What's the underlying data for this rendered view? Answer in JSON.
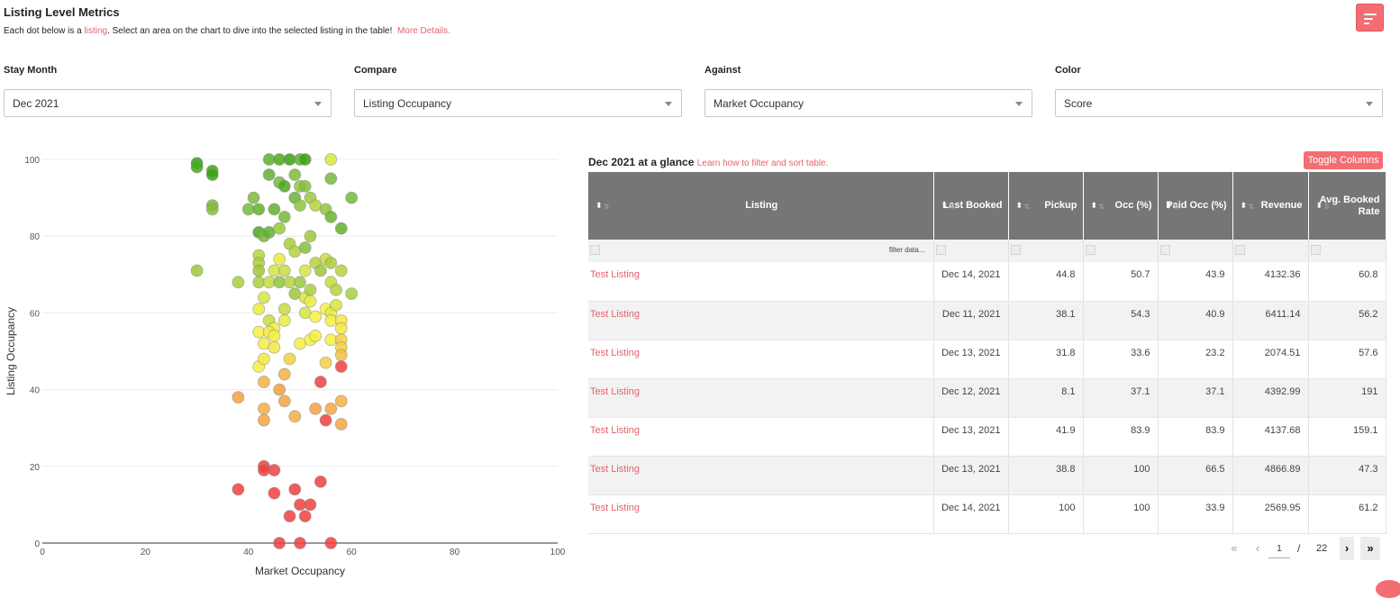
{
  "header": {
    "title": "Listing Level Metrics",
    "subtitle_prefix": "Each dot below is a ",
    "subtitle_link": "listing",
    "subtitle_mid": ". Select an area on the chart to dive into the selected listing in the table!",
    "more_details": "More Details."
  },
  "filters": [
    {
      "label": "Stay Month",
      "value": "Dec 2021"
    },
    {
      "label": "Compare",
      "value": "Listing Occupancy"
    },
    {
      "label": "Against",
      "value": "Market Occupancy"
    },
    {
      "label": "Color",
      "value": "Score"
    }
  ],
  "chart_data": {
    "type": "scatter",
    "xlabel": "Market Occupancy",
    "ylabel": "Listing Occupancy",
    "xlim": [
      0,
      100
    ],
    "ylim": [
      0,
      100
    ],
    "xticks": [
      0,
      20,
      40,
      60,
      80,
      100
    ],
    "yticks": [
      0,
      20,
      40,
      60,
      80,
      100
    ],
    "grid": true,
    "points": [
      {
        "x": 30,
        "y": 99,
        "c": "#34a012"
      },
      {
        "x": 30,
        "y": 98,
        "c": "#4aa81d"
      },
      {
        "x": 33,
        "y": 97,
        "c": "#43a51a"
      },
      {
        "x": 33,
        "y": 96,
        "c": "#3aa116"
      },
      {
        "x": 33,
        "y": 88,
        "c": "#76b83a"
      },
      {
        "x": 33,
        "y": 87,
        "c": "#83c03c"
      },
      {
        "x": 30,
        "y": 71,
        "c": "#9cc83a"
      },
      {
        "x": 38,
        "y": 68,
        "c": "#a8cf3c"
      },
      {
        "x": 40,
        "y": 87,
        "c": "#76b83a"
      },
      {
        "x": 41,
        "y": 90,
        "c": "#7ebb38"
      },
      {
        "x": 42,
        "y": 87,
        "c": "#5fb02d"
      },
      {
        "x": 42,
        "y": 81,
        "c": "#4aa81d"
      },
      {
        "x": 43,
        "y": 80,
        "c": "#76b83a"
      },
      {
        "x": 44,
        "y": 81,
        "c": "#5fb02d"
      },
      {
        "x": 42,
        "y": 75,
        "c": "#b4d33d"
      },
      {
        "x": 42,
        "y": 73,
        "c": "#a8cf3c"
      },
      {
        "x": 42,
        "y": 71,
        "c": "#9cc83a"
      },
      {
        "x": 42,
        "y": 68,
        "c": "#a8cf3c"
      },
      {
        "x": 44,
        "y": 68,
        "c": "#c6dc3e"
      },
      {
        "x": 46,
        "y": 68,
        "c": "#8ec43c"
      },
      {
        "x": 48,
        "y": 68,
        "c": "#b4d33d"
      },
      {
        "x": 44,
        "y": 100,
        "c": "#5fb02d"
      },
      {
        "x": 46,
        "y": 100,
        "c": "#4aa81d"
      },
      {
        "x": 48,
        "y": 100,
        "c": "#3aa116"
      },
      {
        "x": 50,
        "y": 100,
        "c": "#5fb02d"
      },
      {
        "x": 51,
        "y": 100,
        "c": "#3aa116"
      },
      {
        "x": 56,
        "y": 100,
        "c": "#d6e53f"
      },
      {
        "x": 44,
        "y": 96,
        "c": "#5fb02d"
      },
      {
        "x": 46,
        "y": 94,
        "c": "#76b83a"
      },
      {
        "x": 47,
        "y": 93,
        "c": "#4aa81d"
      },
      {
        "x": 49,
        "y": 96,
        "c": "#7ebb38"
      },
      {
        "x": 50,
        "y": 93,
        "c": "#8ec43c"
      },
      {
        "x": 51,
        "y": 93,
        "c": "#83c03c"
      },
      {
        "x": 49,
        "y": 90,
        "c": "#6ab532"
      },
      {
        "x": 50,
        "y": 88,
        "c": "#8ec43c"
      },
      {
        "x": 52,
        "y": 90,
        "c": "#9cc83a"
      },
      {
        "x": 53,
        "y": 88,
        "c": "#b4d33d"
      },
      {
        "x": 55,
        "y": 87,
        "c": "#8ec43c"
      },
      {
        "x": 56,
        "y": 85,
        "c": "#6ab532"
      },
      {
        "x": 56,
        "y": 95,
        "c": "#76b83a"
      },
      {
        "x": 60,
        "y": 90,
        "c": "#76b83a"
      },
      {
        "x": 58,
        "y": 82,
        "c": "#5fb02d"
      },
      {
        "x": 45,
        "y": 87,
        "c": "#5fb02d"
      },
      {
        "x": 47,
        "y": 85,
        "c": "#76b83a"
      },
      {
        "x": 46,
        "y": 82,
        "c": "#9cc83a"
      },
      {
        "x": 48,
        "y": 78,
        "c": "#a8cf3c"
      },
      {
        "x": 49,
        "y": 76,
        "c": "#b4d33d"
      },
      {
        "x": 52,
        "y": 80,
        "c": "#9cc83a"
      },
      {
        "x": 51,
        "y": 77,
        "c": "#83c03c"
      },
      {
        "x": 53,
        "y": 73,
        "c": "#b4d33d"
      },
      {
        "x": 55,
        "y": 74,
        "c": "#c6dc3e"
      },
      {
        "x": 56,
        "y": 73,
        "c": "#a8cf3c"
      },
      {
        "x": 58,
        "y": 71,
        "c": "#b4d33d"
      },
      {
        "x": 51,
        "y": 71,
        "c": "#d6e53f"
      },
      {
        "x": 54,
        "y": 71,
        "c": "#9cc83a"
      },
      {
        "x": 56,
        "y": 68,
        "c": "#c6dc3e"
      },
      {
        "x": 57,
        "y": 66,
        "c": "#b4d33d"
      },
      {
        "x": 60,
        "y": 65,
        "c": "#a8cf3c"
      },
      {
        "x": 49,
        "y": 65,
        "c": "#9cc83a"
      },
      {
        "x": 51,
        "y": 64,
        "c": "#d6e53f"
      },
      {
        "x": 52,
        "y": 66,
        "c": "#a8cf3c"
      },
      {
        "x": 45,
        "y": 71,
        "c": "#d6e53f"
      },
      {
        "x": 46,
        "y": 74,
        "c": "#e8ec3f"
      },
      {
        "x": 47,
        "y": 71,
        "c": "#c6dc3e"
      },
      {
        "x": 50,
        "y": 68,
        "c": "#9cc83a"
      },
      {
        "x": 43,
        "y": 64,
        "c": "#d6e53f"
      },
      {
        "x": 42,
        "y": 61,
        "c": "#e8ec3f"
      },
      {
        "x": 47,
        "y": 61,
        "c": "#c6dc3e"
      },
      {
        "x": 52,
        "y": 63,
        "c": "#e8ec3f"
      },
      {
        "x": 51,
        "y": 60,
        "c": "#d6e53f"
      },
      {
        "x": 53,
        "y": 59,
        "c": "#f5f03f"
      },
      {
        "x": 55,
        "y": 61,
        "c": "#f5f03f"
      },
      {
        "x": 56,
        "y": 60,
        "c": "#e8ec3f"
      },
      {
        "x": 57,
        "y": 62,
        "c": "#d6e53f"
      },
      {
        "x": 56,
        "y": 58,
        "c": "#f5f03f"
      },
      {
        "x": 58,
        "y": 58,
        "c": "#f5e83f"
      },
      {
        "x": 44,
        "y": 58,
        "c": "#c6dc3e"
      },
      {
        "x": 45,
        "y": 56,
        "c": "#f5f03f"
      },
      {
        "x": 47,
        "y": 58,
        "c": "#e8ec3f"
      },
      {
        "x": 42,
        "y": 55,
        "c": "#f5f03f"
      },
      {
        "x": 44,
        "y": 55,
        "c": "#f5e83f"
      },
      {
        "x": 45,
        "y": 54,
        "c": "#f5f03f"
      },
      {
        "x": 43,
        "y": 52,
        "c": "#f5f03f"
      },
      {
        "x": 45,
        "y": 51,
        "c": "#f5e83f"
      },
      {
        "x": 42,
        "y": 46,
        "c": "#f5f03f"
      },
      {
        "x": 43,
        "y": 48,
        "c": "#f5e83f"
      },
      {
        "x": 50,
        "y": 52,
        "c": "#f5f03f"
      },
      {
        "x": 52,
        "y": 53,
        "c": "#f5f03f"
      },
      {
        "x": 53,
        "y": 54,
        "c": "#f5f03f"
      },
      {
        "x": 56,
        "y": 53,
        "c": "#f5f03f"
      },
      {
        "x": 58,
        "y": 56,
        "c": "#f5e83f"
      },
      {
        "x": 58,
        "y": 53,
        "c": "#f5d03f"
      },
      {
        "x": 58,
        "y": 51,
        "c": "#f5d03f"
      },
      {
        "x": 58,
        "y": 49,
        "c": "#f5c03f"
      },
      {
        "x": 55,
        "y": 47,
        "c": "#f5d03f"
      },
      {
        "x": 48,
        "y": 48,
        "c": "#f5d03f"
      },
      {
        "x": 58,
        "y": 46,
        "c": "#f04040"
      },
      {
        "x": 38,
        "y": 38,
        "c": "#f5a03f"
      },
      {
        "x": 43,
        "y": 42,
        "c": "#f5b03f"
      },
      {
        "x": 47,
        "y": 44,
        "c": "#f5b03f"
      },
      {
        "x": 46,
        "y": 40,
        "c": "#f0a03f"
      },
      {
        "x": 47,
        "y": 37,
        "c": "#f5a53f"
      },
      {
        "x": 43,
        "y": 35,
        "c": "#f5b03f"
      },
      {
        "x": 43,
        "y": 32,
        "c": "#f5a53f"
      },
      {
        "x": 49,
        "y": 33,
        "c": "#f5b03f"
      },
      {
        "x": 53,
        "y": 35,
        "c": "#f5a03f"
      },
      {
        "x": 54,
        "y": 42,
        "c": "#f04040"
      },
      {
        "x": 55,
        "y": 32,
        "c": "#f04040"
      },
      {
        "x": 56,
        "y": 35,
        "c": "#f5a53f"
      },
      {
        "x": 58,
        "y": 37,
        "c": "#f5b03f"
      },
      {
        "x": 58,
        "y": 31,
        "c": "#f5a53f"
      },
      {
        "x": 38,
        "y": 14,
        "c": "#f04040"
      },
      {
        "x": 43,
        "y": 20,
        "c": "#f04040"
      },
      {
        "x": 43,
        "y": 19,
        "c": "#f04040"
      },
      {
        "x": 45,
        "y": 19,
        "c": "#f04040"
      },
      {
        "x": 45,
        "y": 13,
        "c": "#f04040"
      },
      {
        "x": 49,
        "y": 14,
        "c": "#f04040"
      },
      {
        "x": 54,
        "y": 16,
        "c": "#f04040"
      },
      {
        "x": 48,
        "y": 7,
        "c": "#f04040"
      },
      {
        "x": 50,
        "y": 10,
        "c": "#f04040"
      },
      {
        "x": 52,
        "y": 10,
        "c": "#f04040"
      },
      {
        "x": 51,
        "y": 7,
        "c": "#f04040"
      },
      {
        "x": 46,
        "y": 0,
        "c": "#f04040"
      },
      {
        "x": 50,
        "y": 0,
        "c": "#f04040"
      },
      {
        "x": 56,
        "y": 0,
        "c": "#f04040"
      }
    ]
  },
  "table": {
    "heading": "Dec 2021 at a glance",
    "learn_link": "Learn how to filter and sort table.",
    "toggle_label": "Toggle Columns",
    "filter_placeholder": "filter data...",
    "columns": [
      "Listing",
      "Last Booked",
      "Pickup",
      "Occ (%)",
      "Paid Occ (%)",
      "Revenue",
      "Avg. Booked Rate"
    ],
    "rows": [
      [
        "Test Listing",
        "Dec 14, 2021",
        "44.8",
        "50.7",
        "43.9",
        "4132.36",
        "60.8"
      ],
      [
        "Test Listing",
        "Dec 11, 2021",
        "38.1",
        "54.3",
        "40.9",
        "6411.14",
        "56.2"
      ],
      [
        "Test Listing",
        "Dec 13, 2021",
        "31.8",
        "33.6",
        "23.2",
        "2074.51",
        "57.6"
      ],
      [
        "Test Listing",
        "Dec 12, 2021",
        "8.1",
        "37.1",
        "37.1",
        "4392.99",
        "191"
      ],
      [
        "Test Listing",
        "Dec 13, 2021",
        "41.9",
        "83.9",
        "83.9",
        "4137.68",
        "159.1"
      ],
      [
        "Test Listing",
        "Dec 13, 2021",
        "38.8",
        "100",
        "66.5",
        "4866.89",
        "47.3"
      ],
      [
        "Test Listing",
        "Dec 14, 2021",
        "100",
        "100",
        "33.9",
        "2569.95",
        "61.2"
      ]
    ]
  },
  "pagination": {
    "first": "«",
    "prev": "‹",
    "current": "1",
    "slash": "/",
    "total": "22",
    "next": "›",
    "last": "»"
  },
  "colors": {
    "accent": "#f36d72",
    "header_bg": "#767676",
    "link": "#e5636d"
  }
}
